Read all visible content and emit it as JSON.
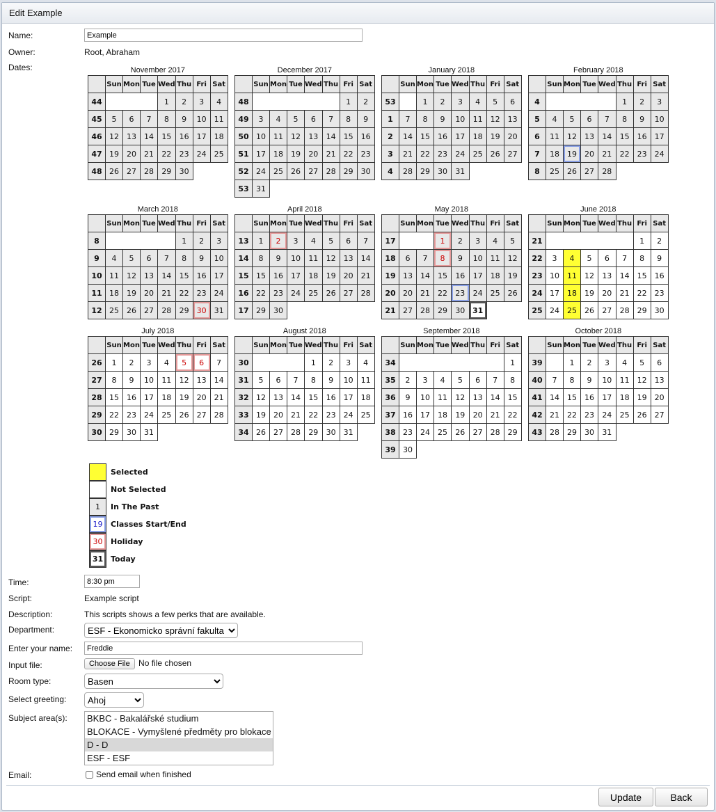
{
  "window_title": "Edit Example",
  "form": {
    "name_label": "Name:",
    "name_value": "Example",
    "owner_label": "Owner:",
    "owner_value": "Root, Abraham",
    "dates_label": "Dates:",
    "time_label": "Time:",
    "time_value": "8:30 pm",
    "script_label": "Script:",
    "script_value": "Example script",
    "description_label": "Description:",
    "description_value": "This scripts shows a few perks that are available.",
    "department_label": "Department:",
    "department_value": "ESF - Ekonomicko správní fakulta",
    "enter_name_label": "Enter your name:",
    "enter_name_value": "Freddie",
    "input_file_label": "Input file:",
    "choose_file_label": "Choose File",
    "no_file_text": "No file chosen",
    "room_type_label": "Room type:",
    "room_type_value": "Basen",
    "greeting_label": "Select greeting:",
    "greeting_value": "Ahoj",
    "subject_label": "Subject area(s):",
    "subject_options": [
      {
        "text": "BKBC - Bakalářské studium",
        "selected": false
      },
      {
        "text": "BLOKACE - Vymyšlené předměty pro blokace",
        "selected": false
      },
      {
        "text": "D - D",
        "selected": true
      },
      {
        "text": "ESF - ESF",
        "selected": false
      }
    ],
    "email_label": "Email:",
    "email_checkbox_label": "Send email when finished",
    "email_checked": false,
    "update_label": "Update",
    "back_label": "Back"
  },
  "weekday_headers": [
    "Sun",
    "Mon",
    "Tue",
    "Wed",
    "Thu",
    "Fri",
    "Sat"
  ],
  "months": [
    {
      "title": "November 2017",
      "first_dow": 3,
      "days": 30,
      "first_week": 44,
      "past_all": true
    },
    {
      "title": "December 2017",
      "first_dow": 5,
      "days": 31,
      "first_week": 48,
      "past_all": true
    },
    {
      "title": "January 2018",
      "first_dow": 1,
      "days": 31,
      "first_week": 53,
      "past_all": true
    },
    {
      "title": "February 2018",
      "first_dow": 4,
      "days": 28,
      "first_week": 4,
      "past_all": true,
      "classes": [
        19
      ]
    },
    {
      "title": "March 2018",
      "first_dow": 4,
      "days": 31,
      "first_week": 8,
      "past_all": true,
      "holiday": [
        30
      ]
    },
    {
      "title": "April 2018",
      "first_dow": 0,
      "days": 30,
      "first_week": 13,
      "past_all": true,
      "holiday": [
        2
      ]
    },
    {
      "title": "May 2018",
      "first_dow": 2,
      "days": 31,
      "first_week": 17,
      "past_until": 30,
      "holiday": [
        1,
        8
      ],
      "classes": [
        23
      ],
      "today": 31
    },
    {
      "title": "June 2018",
      "first_dow": 5,
      "days": 30,
      "first_week": 21,
      "past_until": 0,
      "selected": [
        4,
        11,
        18,
        25
      ]
    },
    {
      "title": "July 2018",
      "first_dow": 0,
      "days": 31,
      "first_week": 26,
      "past_until": 0,
      "holiday": [
        5,
        6
      ]
    },
    {
      "title": "August 2018",
      "first_dow": 3,
      "days": 31,
      "first_week": 30,
      "past_until": 0
    },
    {
      "title": "September 2018",
      "first_dow": 6,
      "days": 30,
      "first_week": 34,
      "past_until": 0
    },
    {
      "title": "October 2018",
      "first_dow": 1,
      "days": 31,
      "first_week": 39,
      "past_until": 0
    }
  ],
  "legend": [
    {
      "key": "selected",
      "box_text": "",
      "label": "Selected"
    },
    {
      "key": "not_selected",
      "box_text": "",
      "label": "Not Selected"
    },
    {
      "key": "past",
      "box_text": "1",
      "label": "In The Past"
    },
    {
      "key": "classes",
      "box_text": "19",
      "label": "Classes Start/End"
    },
    {
      "key": "holiday",
      "box_text": "30",
      "label": "Holiday"
    },
    {
      "key": "today",
      "box_text": "31",
      "label": "Today"
    }
  ]
}
